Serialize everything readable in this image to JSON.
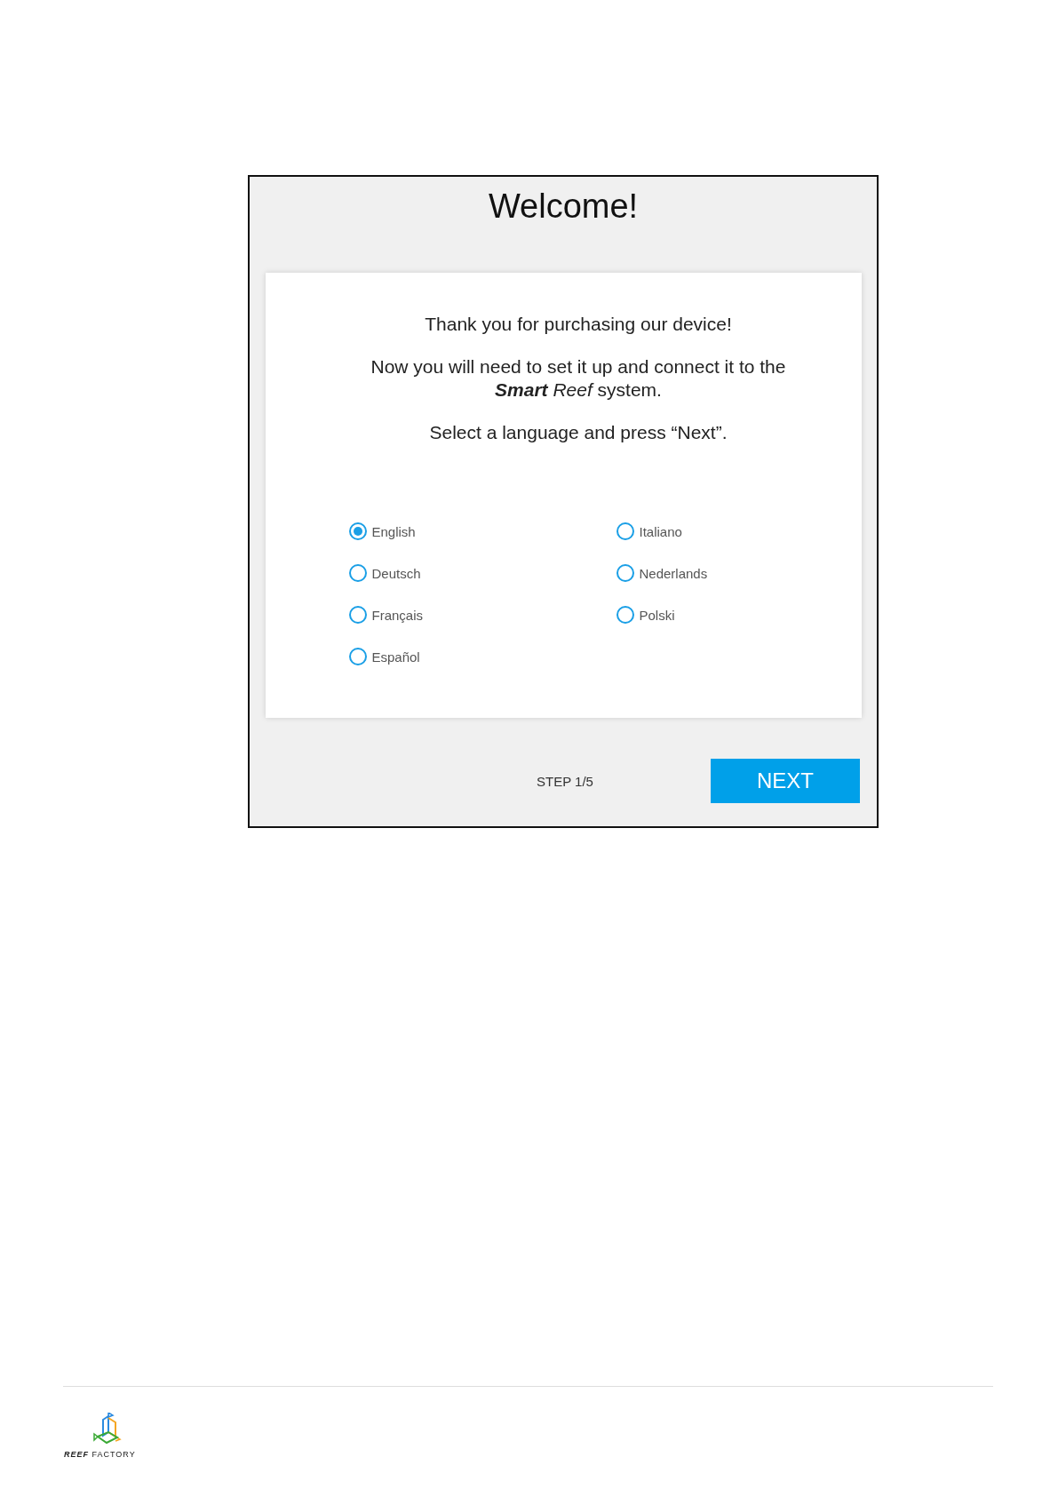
{
  "dialog": {
    "title": "Welcome!",
    "paragraphs": [
      [
        "Thank you for purchasing our device!"
      ],
      [
        "Now you will need to set it up and connect it to the",
        "**Smart** *Reef* system."
      ],
      [
        "Select a language and press “Next”."
      ]
    ],
    "languages": [
      {
        "label": "English",
        "selected": true
      },
      {
        "label": "Italiano",
        "selected": false
      },
      {
        "label": "Deutsch",
        "selected": false
      },
      {
        "label": "Nederlands",
        "selected": false
      },
      {
        "label": "Français",
        "selected": false
      },
      {
        "label": "Polski",
        "selected": false
      },
      {
        "label": "Español",
        "selected": false
      }
    ],
    "step": "STEP 1/5",
    "next_button": "NEXT"
  },
  "footer": {
    "logo_text": "**REEF** FACTORY"
  }
}
